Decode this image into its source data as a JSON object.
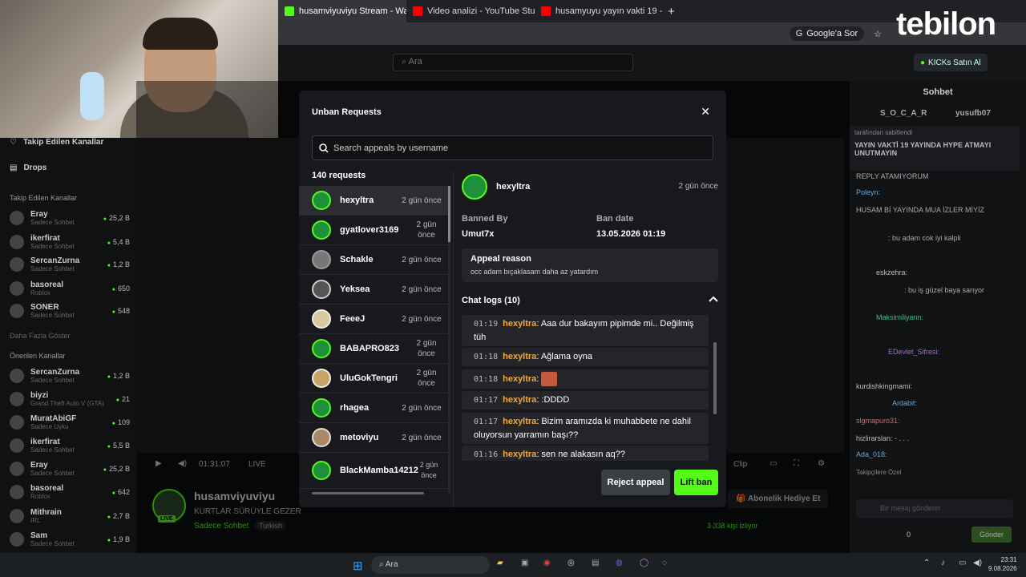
{
  "browser": {
    "tabs": [
      {
        "label": "husamviyuviyu Stream - Watch",
        "color": "#53fc18"
      },
      {
        "label": "Video analizi - YouTube Studio",
        "color": "#ff0000"
      },
      {
        "label": "husamyuyu yayın vakti 19 - You",
        "color": "#ff0000"
      }
    ],
    "new_tab": "+",
    "google_ask": "Google'a Sor",
    "brand": "tebilon"
  },
  "kick": {
    "search_placeholder": "Ara",
    "kicks_button": "KICKs Satın Al",
    "sidebar": {
      "followed": "Takip Edilen Kanallar",
      "drops": "Drops",
      "followed_header": "Takip Edilen Kanallar",
      "followed_channels": [
        {
          "name": "Eray",
          "sub": "Sadece Sohbet",
          "count": "25,2 B"
        },
        {
          "name": "ikerfirat",
          "sub": "Sadece Sohbet",
          "count": "5,4 B"
        },
        {
          "name": "SercanZurna",
          "sub": "Sadece Sohbet",
          "count": "1,2 B"
        },
        {
          "name": "basoreal",
          "sub": "Roblox",
          "count": "650"
        },
        {
          "name": "SONER",
          "sub": "Sadece Sohbet",
          "count": "548"
        }
      ],
      "show_more": "Daha Fazla Göster",
      "recommended_header": "Önerilen Kanallar",
      "recommended_channels": [
        {
          "name": "SercanZurna",
          "sub": "Sadece Sohbet",
          "count": "1,2 B"
        },
        {
          "name": "biyzi",
          "sub": "Grand Theft Auto V (GTA)",
          "count": "21"
        },
        {
          "name": "MuratAbiGF",
          "sub": "Sadece Uyku",
          "count": "109"
        },
        {
          "name": "ikerfirat",
          "sub": "Sadece Sohbet",
          "count": "5,5 B"
        },
        {
          "name": "Eray",
          "sub": "Sadece Sohbet",
          "count": "25,2 B"
        },
        {
          "name": "basoreal",
          "sub": "Roblox",
          "count": "642"
        },
        {
          "name": "Mithrain",
          "sub": "IRL",
          "count": "2,7 B"
        },
        {
          "name": "Sam",
          "sub": "Sadece Sohbet",
          "count": "1,9 B"
        }
      ]
    },
    "player": {
      "time": "01:31:07",
      "live": "LIVE",
      "clip": "Clip"
    },
    "stream": {
      "name": "husamviyuviyu",
      "title": "KURTLAR SÜRÜYLE GEZER",
      "category": "Sadece Sohbet",
      "tag": "Turkish",
      "live_badge": "LIVE",
      "viewers": "3.338 kişi izliyor",
      "gift_button": "Abonelik Hediye Et"
    },
    "chat": {
      "title": "Sohbet",
      "pinned_by": "tarafından sabitlendi",
      "pinned_msg": "YAYIN VAKTİ 19 YAYINDA HYPE ATMAYI UNUTMAYIN",
      "top_users": [
        "S_O_C_A_R",
        "yusufb07"
      ],
      "lines": [
        "REPLY ATAMIYORUM",
        "Poleyn:",
        "HUSAM Bİ YAYINDA MUA İZLER MİYİZ",
        ": bu adam cok iyi kalpli",
        "eskzehra:",
        ": bu iş güzel baya sarıyor",
        "Maksimiliyann:",
        "EDevlet_Sifresi:",
        "kurdishkingmami:",
        "Ardabit:",
        "sigmapuro31:",
        "hizlirarslan: - . . .",
        "Ada_018:"
      ],
      "followers_only": "Takipçilere Özel",
      "input_placeholder": "Bir mesaj gönderin",
      "send": "Gönder",
      "points": "0"
    }
  },
  "modal": {
    "title": "Unban Requests",
    "search_placeholder": "Search appeals by username",
    "count": "140 requests",
    "requests": [
      {
        "user": "hexyltra",
        "time": "2 gün önce"
      },
      {
        "user": "gyatlover3169",
        "time": "2 gün önce"
      },
      {
        "user": "Schakle",
        "time": "2 gün önce"
      },
      {
        "user": "Yeksea",
        "time": "2 gün önce"
      },
      {
        "user": "FeeeJ",
        "time": "2 gün önce"
      },
      {
        "user": "BABAPRO823",
        "time": "2 gün önce"
      },
      {
        "user": "UluGokTengri",
        "time": "2 gün önce"
      },
      {
        "user": "rhagea",
        "time": "2 gün önce"
      },
      {
        "user": "metoviyu",
        "time": "2 gün önce"
      },
      {
        "user": "BlackMamba14212",
        "time": "2 gün önce"
      }
    ],
    "detail": {
      "user": "hexyltra",
      "time": "2 gün önce",
      "banned_by_label": "Banned By",
      "banned_by": "Umut7x",
      "ban_date_label": "Ban date",
      "ban_date": "13.05.2026 01:19",
      "appeal_label": "Appeal reason",
      "appeal_text": "occ adam bıçaklasam daha az yatardım",
      "chat_logs_label": "Chat logs (10)",
      "logs": [
        {
          "time": "01:19",
          "user": "hexyltra",
          "msg": ": Aaa dur bakayım pipimde mi.. Değilmiş tüh"
        },
        {
          "time": "01:18",
          "user": "hexyltra",
          "msg": ": Ağlama oyna"
        },
        {
          "time": "01:18",
          "user": "hexyltra",
          "msg": ":"
        },
        {
          "time": "01:17",
          "user": "hexyltra",
          "msg": ": :DDDD"
        },
        {
          "time": "01:17",
          "user": "hexyltra",
          "msg": ": Bizim aramızda ki muhabbete ne dahil oluyorsun yarramın başı??"
        },
        {
          "time": "01:16",
          "user": "hexyltra",
          "msg": ": sen ne alakasın aq??"
        }
      ],
      "reject_label": "Reject appeal",
      "lift_label": "Lift ban"
    }
  },
  "taskbar": {
    "search": "Ara",
    "time": "23:31",
    "date": "9.08.2026"
  }
}
